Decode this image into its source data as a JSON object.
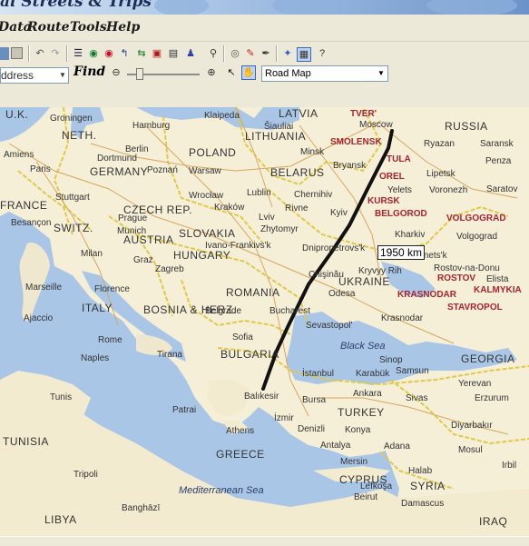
{
  "window": {
    "title": "al Streets & Trips"
  },
  "menu": {
    "data": "Data",
    "route": "Route",
    "tools": "Tools",
    "help": "Help"
  },
  "address": {
    "value": "ddress"
  },
  "find_label": "Find",
  "map_style": {
    "value": "Road Map"
  },
  "route": {
    "distance_label": "1950 km"
  },
  "map": {
    "countries": [
      "U.K.",
      "NETH.",
      "GERMANY",
      "POLAND",
      "LATVIA",
      "LITHUANIA",
      "BELARUS",
      "RUSSIA",
      "FRANCE",
      "SWITZ.",
      "CZECH REP.",
      "SLOVAKIA",
      "AUSTRIA",
      "HUNGARY",
      "UKRAINE",
      "ROMANIA",
      "ITALY",
      "BOSNIA & HERZ.",
      "BULGARIA",
      "GEORGIA",
      "TURKEY",
      "GREECE",
      "TUNISIA",
      "CYPRUS",
      "SYRIA",
      "LIBYA",
      "IRAQ"
    ],
    "regions": [
      "TVER'",
      "SMOLENSK",
      "TULA",
      "OREL",
      "KURSK",
      "BELGOROD",
      "VOLGOGRAD",
      "KRASNODAR",
      "ROSTOV",
      "KALMYKIA",
      "STAVROPOL"
    ],
    "cities": [
      "Groningen",
      "Hamburg",
      "Klaipeda",
      "Šiauliai",
      "Moscow",
      "Ryazan",
      "Saransk",
      "Amiens",
      "Dortmund",
      "Berlin",
      "Paris",
      "Poznań",
      "Minsk",
      "Bryansk",
      "Lipetsk",
      "Penza",
      "Stuttgart",
      "Warsaw",
      "Wrocław",
      "Lublin",
      "Chernihiv",
      "Yelets",
      "Voronezh",
      "Saratov",
      "Prague",
      "Kraków",
      "Rivne",
      "Kyiv",
      "Besançon",
      "Lviv",
      "Zhytomyr",
      "Munich",
      "Ivano-Frankivs'k",
      "Kharkiv",
      "Volgograd",
      "Milan",
      "Graz",
      "Zagreb",
      "Dnipropetrovs'k",
      "Donets'k",
      "Marseille",
      "Florence",
      "Kryvyy Rih",
      "Rostov-na-Donu",
      "Elista",
      "Ajaccio",
      "Chişinău",
      "Odesa",
      "Belgrade",
      "Bucharest",
      "Krasnodar",
      "Rome",
      "Sevastopol'",
      "Naples",
      "Sofia",
      "Sinop",
      "Samsun",
      "Tirana",
      "İstanbul",
      "Karabük",
      "Tunis",
      "Patrai",
      "Balıkesir",
      "Bursa",
      "Ankara",
      "Sivas",
      "Erzurum",
      "Yerevan",
      "Athens",
      "İzmir",
      "Diyarbakır",
      "Denizli",
      "Konya",
      "Antalya",
      "Adana",
      "Mosul",
      "Tripoli",
      "Mersin",
      "Halab",
      "Irbil",
      "Beirut",
      "Damascus",
      "Banghāzī",
      "Lefkoşa"
    ],
    "seas": [
      "Black Sea",
      "Mediterranean Sea"
    ]
  }
}
